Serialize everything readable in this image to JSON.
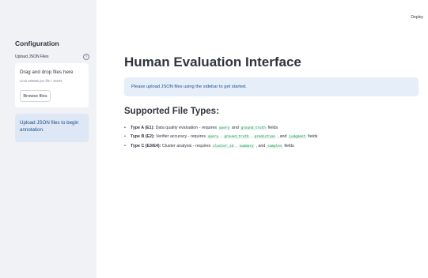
{
  "header": {
    "deploy_label": "Deploy"
  },
  "sidebar": {
    "title": "Configuration",
    "upload_label": "Upload JSON Files",
    "help_glyph": "?",
    "dropzone": {
      "title": "Drag and drop files here",
      "limit": "Limit 200MB per file • JSON",
      "browse_label": "Browse files"
    },
    "info": "Upload JSON files to begin annotation."
  },
  "main": {
    "title": "Human Evaluation Interface",
    "info": "Please upload JSON files using the sidebar to get started.",
    "section_title": "Supported File Types:",
    "types": [
      {
        "label": "Type A (E1):",
        "text": " Data quality evaluation - requires ",
        "code1": "query",
        "sep1": " and ",
        "code2": "ground_truth",
        "tail": " fields"
      },
      {
        "label": "Type B (E2):",
        "text": " Verifier accuracy - requires ",
        "code1": "query",
        "sep1": " , ",
        "code2": "ground_truth",
        "sep2": " , ",
        "code3": "prediction",
        "sep3": " , and ",
        "code4": "judgment",
        "tail": " fields"
      },
      {
        "label": "Type C (E3/E4):",
        "text": " Cluster analysis - requires ",
        "code1": "cluster_id",
        "sep1": " , ",
        "code2": "summary",
        "sep2": " , and ",
        "code3": "samples",
        "tail": " fields"
      }
    ]
  },
  "colors": {
    "sidebar_bg": "#f0f2f6",
    "info_bg": "#e6eef9",
    "info_text": "#1c4e8a",
    "code_text": "#09ab3b"
  }
}
